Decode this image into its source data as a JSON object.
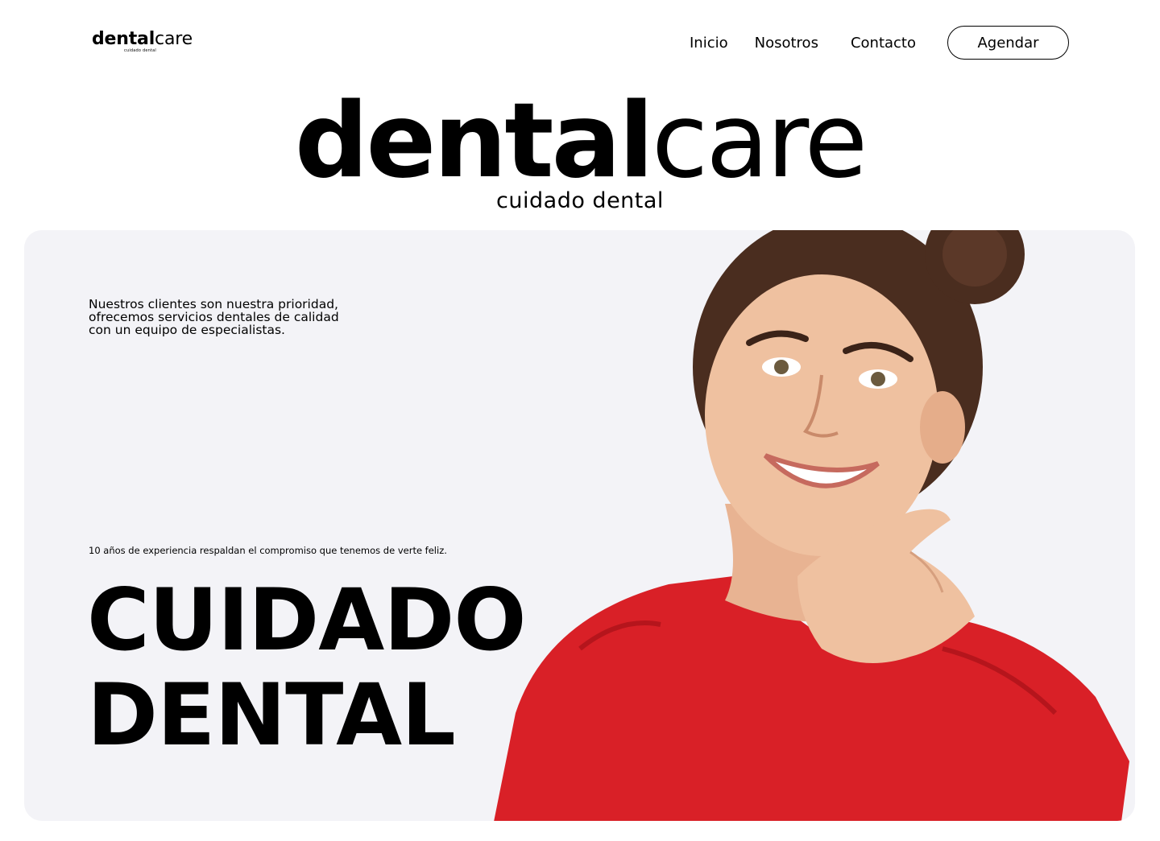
{
  "header": {
    "logo": {
      "bold": "dental",
      "light": "care",
      "tagline": "cuidado dental"
    },
    "nav": [
      {
        "label": "Inicio"
      },
      {
        "label": "Nosotros"
      },
      {
        "label": "Contacto"
      }
    ],
    "cta_label": "Agendar"
  },
  "brand": {
    "bold": "dental",
    "light": "care",
    "subtitle": "cuidado dental"
  },
  "hero": {
    "intro_lines": [
      "Nuestros clientes son nuestra prioridad,",
      "ofrecemos servicios dentales de calidad",
      "con un equipo de especialistas."
    ],
    "experience": "10 años de experiencia respaldan el compromiso que tenemos de verte feliz.",
    "headline": [
      "CUIDADO",
      "DENTAL"
    ]
  },
  "colors": {
    "accent": "#d92027",
    "hero_background": "#f3f3f7",
    "text": "#000000"
  }
}
